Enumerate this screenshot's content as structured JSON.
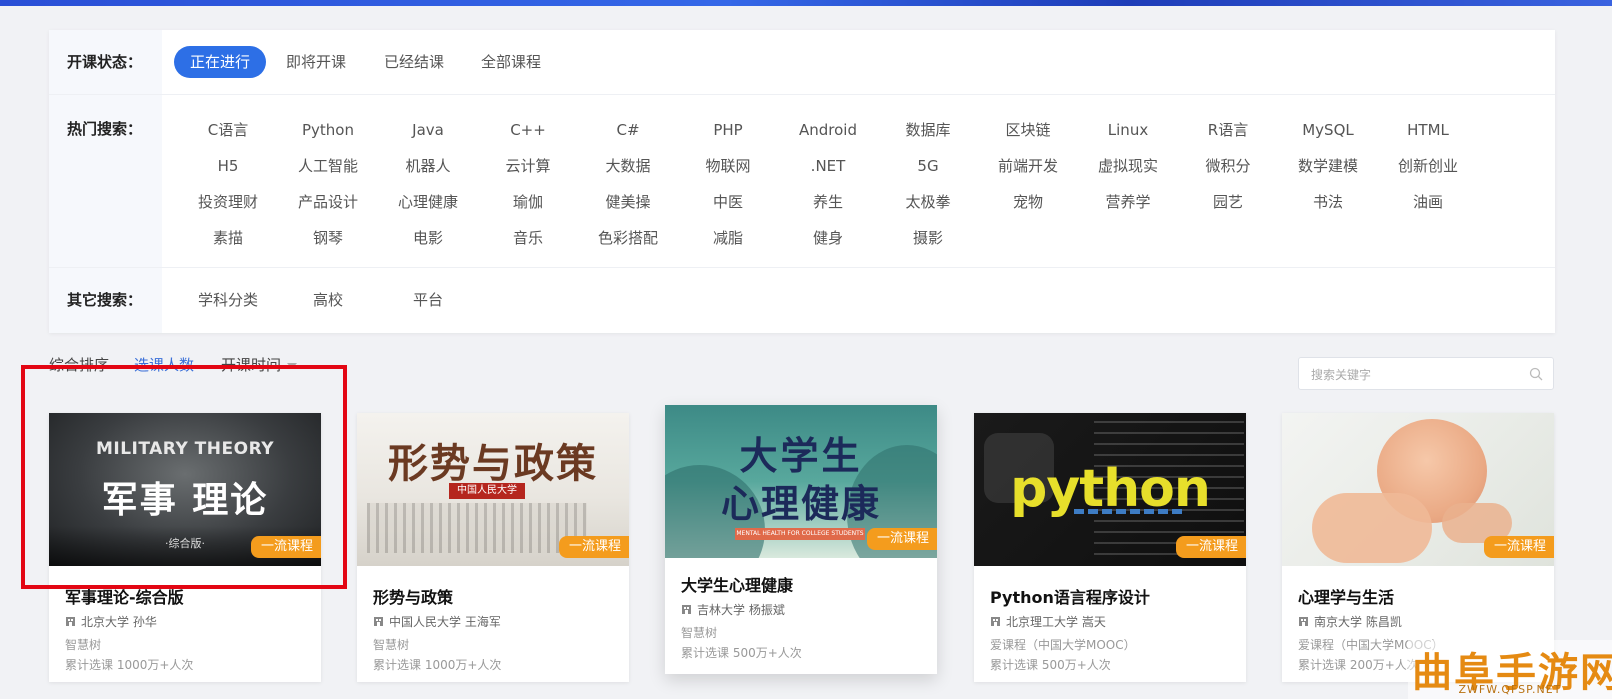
{
  "filters": {
    "status": {
      "label": "开课状态：",
      "options": [
        "正在进行",
        "即将开课",
        "已经结课",
        "全部课程"
      ],
      "active": "正在进行"
    },
    "hot": {
      "label": "热门搜索：",
      "items": [
        "C语言",
        "Python",
        "Java",
        "C++",
        "C#",
        "PHP",
        "Android",
        "数据库",
        "区块链",
        "Linux",
        "R语言",
        "MySQL",
        "HTML",
        "H5",
        "人工智能",
        "机器人",
        "云计算",
        "大数据",
        "物联网",
        ".NET",
        "5G",
        "前端开发",
        "虚拟现实",
        "微积分",
        "数学建模",
        "创新创业",
        "投资理财",
        "产品设计",
        "心理健康",
        "瑜伽",
        "健美操",
        "中医",
        "养生",
        "太极拳",
        "宠物",
        "营养学",
        "园艺",
        "书法",
        "油画",
        "素描",
        "钢琴",
        "电影",
        "音乐",
        "色彩搭配",
        "减脂",
        "健身",
        "摄影"
      ]
    },
    "other": {
      "label": "其它搜索：",
      "items": [
        "学科分类",
        "高校",
        "平台"
      ]
    }
  },
  "sort": {
    "options": [
      "综合排序",
      "选课人数",
      "开课时间"
    ],
    "active": "选课人数"
  },
  "search": {
    "placeholder": "搜索关键字"
  },
  "cards": [
    {
      "thumb_en": "MILITARY THEORY",
      "thumb_cn": "军事 理论",
      "thumb_sub": "·综合版·",
      "badge": "一流课程",
      "title": "军事理论-综合版",
      "school": "北京大学 孙华",
      "platform": "智慧树",
      "count": "累计选课 1000万+人次"
    },
    {
      "thumb_cn": "形势与政策",
      "thumb_sub": "中国人民大学",
      "badge": "一流课程",
      "title": "形势与政策",
      "school": "中国人民大学 王海军",
      "platform": "智慧树",
      "count": "累计选课 1000万+人次"
    },
    {
      "thumb_cn": "大学生",
      "thumb_cn2": "心理健康",
      "thumb_sub": "MENTAL HEALTH FOR COLLEGE STUDENTS",
      "badge": "一流课程",
      "title": "大学生心理健康",
      "school": "吉林大学 杨振斌",
      "platform": "智慧树",
      "count": "累计选课 500万+人次"
    },
    {
      "thumb_en": "python",
      "badge": "一流课程",
      "title": "Python语言程序设计",
      "school": "北京理工大学 嵩天",
      "platform": "爱课程（中国大学MOOC）",
      "count": "累计选课 500万+人次"
    },
    {
      "badge": "一流课程",
      "title": "心理学与生活",
      "school": "南京大学 陈昌凯",
      "platform": "爱课程（中国大学MOOC）",
      "count": "累计选课 200万+人次"
    }
  ],
  "watermark": {
    "main": "曲阜手游网",
    "sub": "ZWFW.QFSP.NET"
  },
  "colors": {
    "accent": "#2d6fe6",
    "badge": "#f49c1d",
    "highlight_box": "#e30613"
  }
}
